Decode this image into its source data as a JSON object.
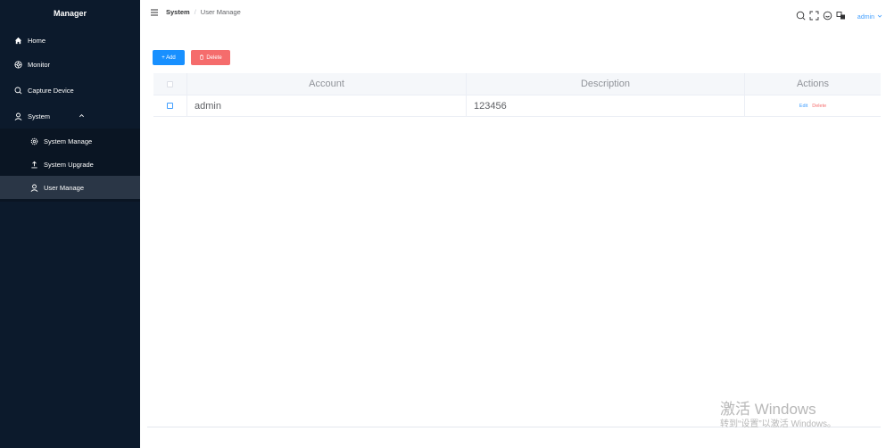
{
  "sidebar": {
    "brand": "Manager",
    "items": [
      {
        "label": "Home",
        "icon": "home-icon"
      },
      {
        "label": "Monitor",
        "icon": "aperture-icon"
      },
      {
        "label": "Capture Device",
        "icon": "search-icon"
      },
      {
        "label": "System",
        "icon": "user-icon"
      }
    ],
    "submenu": [
      {
        "label": "System Manage",
        "icon": "gear-icon"
      },
      {
        "label": "System Upgrade",
        "icon": "upload-icon"
      },
      {
        "label": "User Manage",
        "icon": "user-icon"
      }
    ]
  },
  "header": {
    "breadcrumb": [
      "System",
      "/",
      "User Manage"
    ],
    "user": "admin",
    "icons": [
      "search-icon",
      "fullscreen-icon",
      "help-icon",
      "language-icon"
    ]
  },
  "toolbar": {
    "add_label": "+ Add",
    "delete_label": "Delete"
  },
  "table": {
    "columns": [
      "Account",
      "Description",
      "Actions"
    ],
    "rows": [
      {
        "account": "admin",
        "description": "123456",
        "edit": "Edit",
        "delete": "Delete"
      }
    ]
  },
  "watermark": {
    "line1": "激活 Windows",
    "line2": "转到“设置”以激活 Windows。"
  },
  "colors": {
    "sidebar_bg": "#0c1a2c",
    "primary": "#1890ff",
    "danger": "#f56c6c",
    "link": "#409eff"
  }
}
